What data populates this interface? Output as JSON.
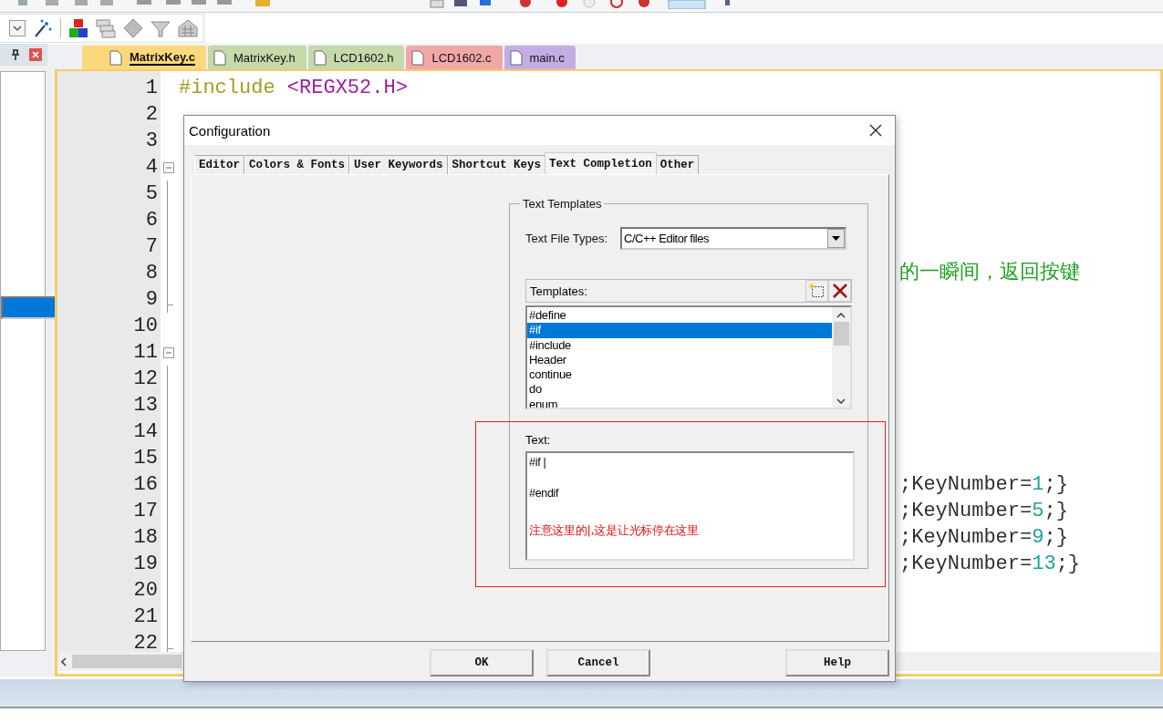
{
  "file_tabs": [
    {
      "label": "MatrixKey.c",
      "selected": true,
      "color": "#fcd87c"
    },
    {
      "label": "MatrixKey.h",
      "selected": false,
      "color": "#c6d9a9"
    },
    {
      "label": "LCD1602.h",
      "selected": false,
      "color": "#c6d9a9"
    },
    {
      "label": "LCD1602.c",
      "selected": false,
      "color": "#f2a7a7"
    },
    {
      "label": "main.c",
      "selected": false,
      "color": "#c4ade3"
    }
  ],
  "project_panel": {
    "items": [
      {
        "selected": true
      }
    ]
  },
  "editor": {
    "lines": [
      {
        "number": "1",
        "left": [
          {
            "text": "#include ",
            "kind": "directive"
          },
          {
            "text": "<REGX52.H>",
            "kind": "header"
          }
        ]
      },
      {
        "number": "2"
      },
      {
        "number": "3"
      },
      {
        "number": "4",
        "expanded": true,
        "children": [
          {
            "number": "5"
          },
          {
            "number": "6"
          },
          {
            "number": "7"
          },
          {
            "number": "8",
            "right": [
              {
                "text": "的一瞬间，返回按键",
                "kind": "comment"
              }
            ]
          },
          {
            "number": "9"
          }
        ]
      },
      {
        "number": "10"
      },
      {
        "number": "11",
        "expanded": true,
        "children": [
          {
            "number": "12"
          },
          {
            "number": "13"
          },
          {
            "number": "14"
          },
          {
            "number": "15"
          },
          {
            "number": "16",
            "right": [
              {
                "text": ";KeyNumber=",
                "kind": "plain"
              },
              {
                "text": "1",
                "kind": "number"
              },
              {
                "text": ";}",
                "kind": "plain"
              }
            ]
          },
          {
            "number": "17",
            "right": [
              {
                "text": ";KeyNumber=",
                "kind": "plain"
              },
              {
                "text": "5",
                "kind": "number"
              },
              {
                "text": ";}",
                "kind": "plain"
              }
            ]
          },
          {
            "number": "18",
            "right": [
              {
                "text": ";KeyNumber=",
                "kind": "plain"
              },
              {
                "text": "9",
                "kind": "number"
              },
              {
                "text": ";}",
                "kind": "plain"
              }
            ]
          },
          {
            "number": "19",
            "right": [
              {
                "text": ";KeyNumber=",
                "kind": "plain"
              },
              {
                "text": "13",
                "kind": "number"
              },
              {
                "text": ";}",
                "kind": "plain"
              }
            ]
          },
          {
            "number": "20"
          },
          {
            "number": "21"
          },
          {
            "number": "22"
          }
        ]
      }
    ]
  },
  "dialog": {
    "title": "Configuration",
    "tabs": [
      {
        "label": "Editor",
        "selected": false
      },
      {
        "label": "Colors & Fonts",
        "selected": false
      },
      {
        "label": "User Keywords",
        "selected": false
      },
      {
        "label": "Shortcut Keys",
        "selected": false
      },
      {
        "label": "Text Completion",
        "selected": true
      },
      {
        "label": "Other",
        "selected": false
      }
    ],
    "group_title": "Text Templates",
    "file_types_label": "Text File Types:",
    "file_types_value": "C/C++ Editor files",
    "templates_label": "Templates:",
    "templates": [
      {
        "label": "#define",
        "selected": false
      },
      {
        "label": "#if",
        "selected": true
      },
      {
        "label": "#include",
        "selected": false
      },
      {
        "label": "Header",
        "selected": false
      },
      {
        "label": "continue",
        "selected": false
      },
      {
        "label": "do",
        "selected": false
      },
      {
        "label": "enum",
        "selected": false
      }
    ],
    "text_label": "Text:",
    "text_value": "#if |\n\n#endif",
    "annotation": "注意这里的|,这是让光标停在这里",
    "buttons": [
      "OK",
      "Cancel",
      "Help"
    ]
  }
}
